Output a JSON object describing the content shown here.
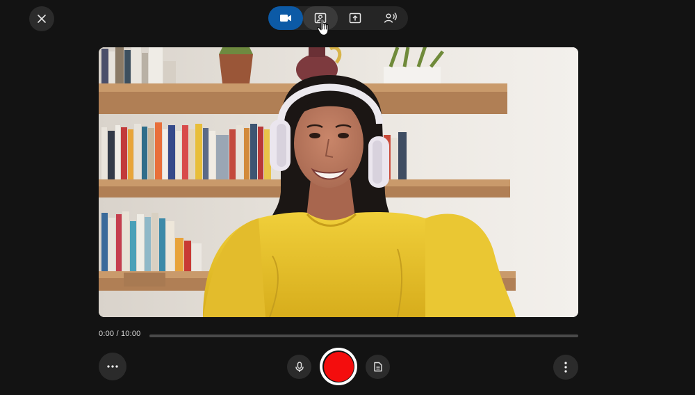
{
  "window": {
    "close_icon": "close-icon"
  },
  "mode_toolbar": {
    "active_mode": "camera",
    "modes": [
      {
        "id": "camera",
        "icon": "video-camera-icon",
        "state": "active"
      },
      {
        "id": "camera-and-screen",
        "icon": "portrait-frame-icon",
        "state": "hover"
      },
      {
        "id": "screen",
        "icon": "screen-share-icon",
        "state": "default"
      },
      {
        "id": "audio",
        "icon": "voice-icon",
        "state": "default"
      }
    ]
  },
  "preview": {
    "subject": "camera-feed"
  },
  "timeline": {
    "time_display": "0:00 / 10:00",
    "progress": 0
  },
  "controls": {
    "more_options_icon": "more-horizontal-icon",
    "microphone_icon": "microphone-icon",
    "record_icon": "record-icon",
    "notes_icon": "document-icon",
    "menu_icon": "more-vertical-icon"
  },
  "colors": {
    "background": "#131313",
    "accent": "#0c5aa6",
    "record": "#f40d0d"
  }
}
